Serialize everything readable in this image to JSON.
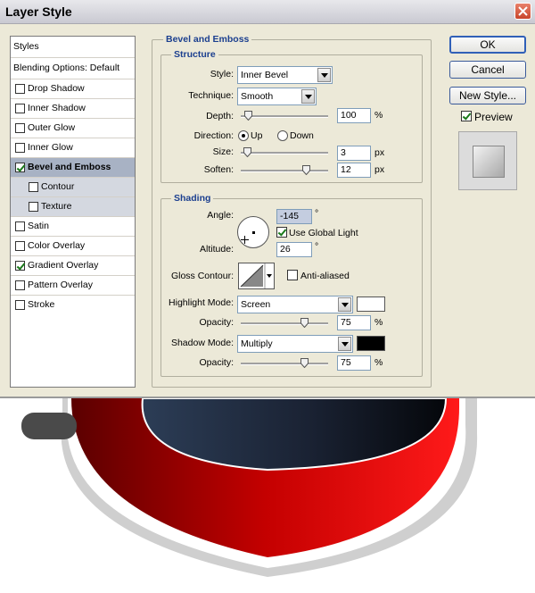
{
  "window": {
    "title": "Layer Style"
  },
  "styles_panel": {
    "header": "Styles",
    "items": [
      {
        "label": "Blending Options: Default",
        "checkbox": false
      },
      {
        "label": "Drop Shadow",
        "checked": false
      },
      {
        "label": "Inner Shadow",
        "checked": false
      },
      {
        "label": "Outer Glow",
        "checked": false
      },
      {
        "label": "Inner Glow",
        "checked": false
      },
      {
        "label": "Bevel and Emboss",
        "checked": true,
        "selected": true
      },
      {
        "label": "Contour",
        "checked": false,
        "sub": true
      },
      {
        "label": "Texture",
        "checked": false,
        "sub": true
      },
      {
        "label": "Satin",
        "checked": false
      },
      {
        "label": "Color Overlay",
        "checked": false
      },
      {
        "label": "Gradient Overlay",
        "checked": true
      },
      {
        "label": "Pattern Overlay",
        "checked": false
      },
      {
        "label": "Stroke",
        "checked": false
      }
    ]
  },
  "bevel": {
    "group_title": "Bevel and Emboss",
    "structure": {
      "title": "Structure",
      "style_label": "Style:",
      "style_value": "Inner Bevel",
      "technique_label": "Technique:",
      "technique_value": "Smooth",
      "depth_label": "Depth:",
      "depth_value": "100",
      "depth_unit": "%",
      "direction_label": "Direction:",
      "direction_up": "Up",
      "direction_down": "Down",
      "size_label": "Size:",
      "size_value": "3",
      "size_unit": "px",
      "soften_label": "Soften:",
      "soften_value": "12",
      "soften_unit": "px"
    },
    "shading": {
      "title": "Shading",
      "angle_label": "Angle:",
      "angle_value": "-145",
      "angle_unit": "°",
      "global_light_label": "Use Global Light",
      "altitude_label": "Altitude:",
      "altitude_value": "26",
      "altitude_unit": "°",
      "gloss_label": "Gloss Contour:",
      "anti_aliased_label": "Anti-aliased",
      "highlight_mode_label": "Highlight Mode:",
      "highlight_mode_value": "Screen",
      "highlight_opacity_label": "Opacity:",
      "highlight_opacity_value": "75",
      "highlight_opacity_unit": "%",
      "shadow_mode_label": "Shadow Mode:",
      "shadow_mode_value": "Multiply",
      "shadow_opacity_label": "Opacity:",
      "shadow_opacity_value": "75",
      "shadow_opacity_unit": "%"
    }
  },
  "slider_levels": {
    "depth": 0.05,
    "size": 0.03,
    "soften": 0.78,
    "highlight_opacity": 0.75,
    "shadow_opacity": 0.75
  },
  "buttons": {
    "ok": "OK",
    "cancel": "Cancel",
    "new_style": "New Style...",
    "preview": "Preview"
  },
  "colors": {
    "highlight": "#ffffff",
    "shadow": "#000000",
    "accent_title": "#1b3f8f",
    "selection": "#a8b2c4"
  },
  "icons": [
    "close-icon",
    "dropdown-arrow-icon",
    "slider-thumb-icon",
    "angle-dial-icon",
    "gloss-contour-icon"
  ]
}
